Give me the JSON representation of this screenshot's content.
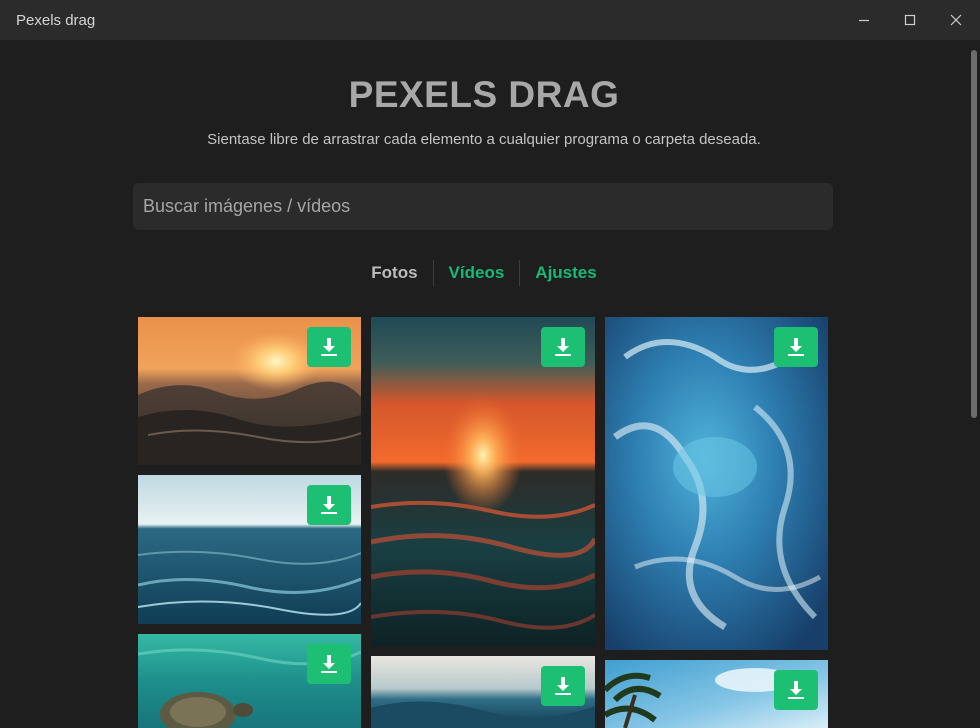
{
  "window": {
    "title": "Pexels drag"
  },
  "header": {
    "title": "PEXELS DRAG",
    "subtitle": "Sientase libre de arrastrar cada elemento a cualquier programa o carpeta deseada."
  },
  "search": {
    "placeholder": "Buscar imágenes / vídeos",
    "value": ""
  },
  "tabs": [
    {
      "label": "Fotos",
      "active": true
    },
    {
      "label": "Vídeos",
      "active": false
    },
    {
      "label": "Ajustes",
      "active": false
    }
  ],
  "colors": {
    "accent": "#1dbf73",
    "link": "#17b978",
    "background": "#1e1e1e",
    "titlebar": "#2b2b2b"
  },
  "gallery": {
    "download_icon": "download-icon",
    "items": [
      {
        "subject": "sunset-over-waves"
      },
      {
        "subject": "open-ocean-horizon"
      },
      {
        "subject": "sea-turtle-underwater"
      },
      {
        "subject": "orange-sunset-sea"
      },
      {
        "subject": "ocean-wave-blue"
      },
      {
        "subject": "aerial-sea-foam"
      },
      {
        "subject": "palm-trees-sky"
      }
    ]
  }
}
